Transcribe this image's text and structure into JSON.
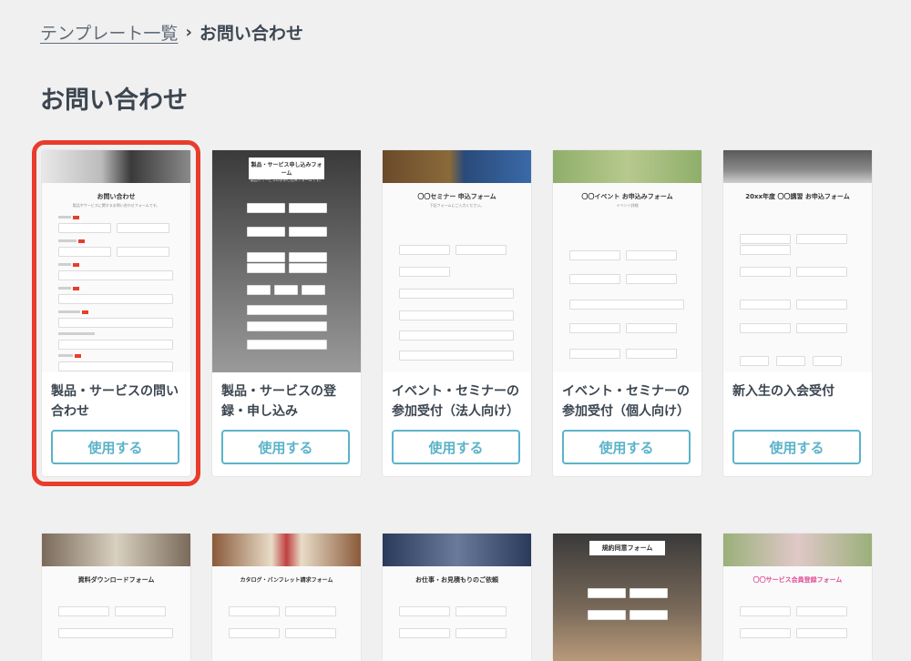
{
  "breadcrumb": {
    "parent": "テンプレート一覧",
    "separator": "›",
    "current": "お問い合わせ"
  },
  "page_title": "お問い合わせ",
  "use_button_label": "使用する",
  "colors": {
    "accent": "#5bb3c9",
    "highlight": "#e83c2c",
    "background": "#f0f0f0",
    "required_badge": "#e83c2c"
  },
  "cards": [
    {
      "title": "製品・サービスの問い合わせ",
      "preview_title": "お問い合わせ",
      "preview_desc": "製品やサービスに関するお問い合わせフォームです。",
      "highlighted": true
    },
    {
      "title": "製品・サービスの登録・申し込み",
      "preview_title": "製品・サービス申し込みフォーム",
      "preview_desc": "製品やサービスのお申し込みフォームです。"
    },
    {
      "title": "イベント・セミナーの参加受付（法人向け）",
      "preview_title": "〇〇セミナー 申込フォーム",
      "preview_desc": "下記フォームにご入力ください。"
    },
    {
      "title": "イベント・セミナーの参加受付（個人向け）",
      "preview_title": "〇〇イベント お申込みフォーム",
      "preview_desc": "イベント詳細"
    },
    {
      "title": "新入生の入会受付",
      "preview_title": "20xx年度 〇〇講習 お申込フォーム",
      "preview_desc": ""
    },
    {
      "title": "",
      "preview_title": "資料ダウンロードフォーム",
      "preview_desc": ""
    },
    {
      "title": "",
      "preview_title": "カタログ・パンフレット請求フォーム",
      "preview_desc": ""
    },
    {
      "title": "",
      "preview_title": "お仕事・お見積もりのご依頼",
      "preview_desc": ""
    },
    {
      "title": "",
      "preview_title": "規約同意フォーム",
      "preview_desc": ""
    },
    {
      "title": "",
      "preview_title": "〇〇サービス会員登録フォーム",
      "preview_desc": ""
    }
  ]
}
